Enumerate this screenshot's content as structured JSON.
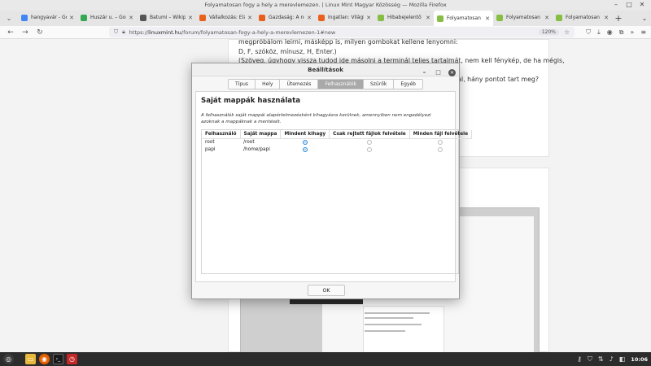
{
  "window": {
    "title": "Folyamatosan fogy a hely a merevlemezen. | Linux Mint Magyar Közösség — Mozilla Firefox"
  },
  "tabs": [
    {
      "label": "hangyavár - Google",
      "color": "#4285f4",
      "active": false
    },
    {
      "label": "Huszár u. – Google T",
      "color": "#34a853",
      "active": false
    },
    {
      "label": "Batumi – Wikipédia",
      "color": "#555555",
      "active": false
    },
    {
      "label": "Vállalkozás: Elárulta",
      "color": "#e8601c",
      "active": false
    },
    {
      "label": "Gazdaság: A nettó á",
      "color": "#e8601c",
      "active": false
    },
    {
      "label": "Ingatlan: Világhírű g",
      "color": "#e8601c",
      "active": false
    },
    {
      "label": "Hibabejelentő | Linu",
      "color": "#86be43",
      "active": false
    },
    {
      "label": "Folyamatosan fogy",
      "color": "#86be43",
      "active": true
    },
    {
      "label": "Folyamatosan fogy",
      "color": "#86be43",
      "active": false
    },
    {
      "label": "Folyamatosan fogy",
      "color": "#86be43",
      "active": false
    }
  ],
  "nav": {
    "url_prefix": "https://",
    "url_host": "linuxmint.hu",
    "url_path": "/forum/folyamatosan-fogy-a-hely-a-merevlemezen-1#new",
    "zoom": "120%"
  },
  "post": {
    "lines": [
      "megpróbálom leírni, másképp is, milyen gombokat kellene lenyomni:",
      "D, F, szóköz, mínusz, H, Enter.)",
      "(Szöveg, úgyhogy vissza tudod ide másolni a terminál teljes tartalmát, nem kell fénykép, de ha mégis,",
      "",
      "al, hány pontot tart meg?"
    ]
  },
  "dialog": {
    "title": "Beállítások",
    "tabs": [
      {
        "label": "Típus",
        "active": false
      },
      {
        "label": "Hely",
        "active": false
      },
      {
        "label": "Ütemezés",
        "active": false
      },
      {
        "label": "Felhasználók",
        "active": true
      },
      {
        "label": "Szűrők",
        "active": false
      },
      {
        "label": "Egyéb",
        "active": false
      }
    ],
    "section_title": "Saját mappák használata",
    "section_desc": "A felhasználók saját mappái alapértelmezésként kihagyásra kerülnek, amennyiben nem engedélyezi azoknak a mappáknak a mentését.",
    "columns": [
      "Felhasználó",
      "Saját mappa",
      "Mindent kihagy",
      "Csak rejtett fájlok felvétele",
      "Minden fájl felvétele"
    ],
    "rows": [
      {
        "user": "root",
        "home": "/root",
        "selected": 0
      },
      {
        "user": "papi",
        "home": "/home/papi",
        "selected": 0
      }
    ],
    "ok_label": "OK"
  },
  "taskbar": {
    "clock": "10:06"
  }
}
